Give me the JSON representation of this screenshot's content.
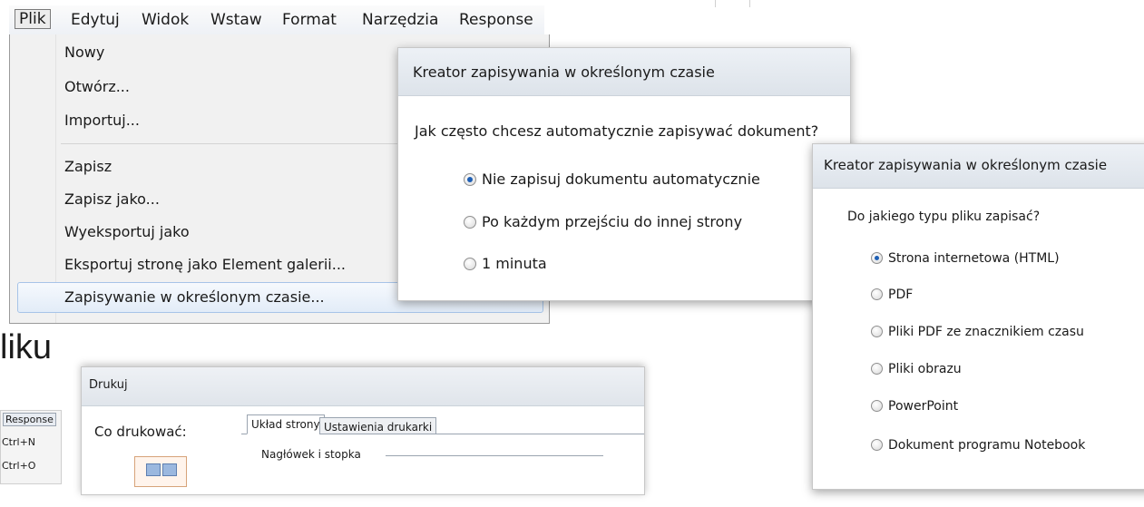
{
  "menubar": {
    "items": [
      "Plik",
      "Edytuj",
      "Widok",
      "Wstaw",
      "Format",
      "Narzędzia",
      "Response"
    ]
  },
  "file_menu": {
    "items": [
      "Nowy",
      "Otwórz...",
      "Importuj...",
      "Zapisz",
      "Zapisz jako...",
      "Wyeksportuj jako",
      "Eksportuj stronę jako Element galerii...",
      "Zapisywanie w określonym czasie..."
    ]
  },
  "big_text": "liku",
  "wizard_interval": {
    "title": "Kreator zapisywania w określonym czasie",
    "question": "Jak często chcesz automatycznie zapisywać dokument?",
    "options": [
      "Nie zapisuj dokumentu automatycznie",
      "Po każdym przejściu do innej strony",
      "1 minuta"
    ],
    "selected_index": 0
  },
  "wizard_filetype": {
    "title": "Kreator zapisywania w określonym czasie",
    "question": "Do jakiego typu pliku zapisać?",
    "options": [
      "Strona internetowa (HTML)",
      "PDF",
      "Pliki PDF ze znacznikiem czasu",
      "Pliki obrazu",
      "PowerPoint",
      "Dokument programu Notebook"
    ],
    "selected_index": 0
  },
  "print_dialog": {
    "title": "Drukuj",
    "what_label": "Co drukować:",
    "tabs": [
      "Układ strony",
      "Ustawienia drukarki"
    ],
    "group_label": "Nagłówek i stopka"
  },
  "mini_menu": {
    "header": "Response",
    "shortcuts": [
      "Ctrl+N",
      "Ctrl+O"
    ]
  },
  "colors": {
    "selected_radio": "#1e5fb4",
    "highlight_border": "#a7c4e8"
  }
}
